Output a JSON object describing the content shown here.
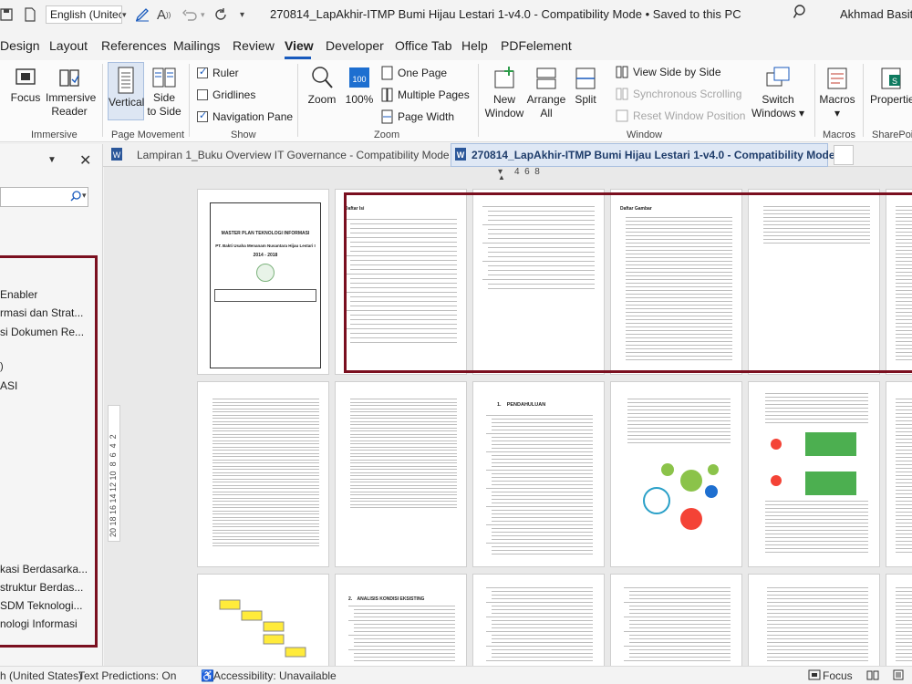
{
  "titlebar": {
    "language": "English (Unitec",
    "title": "270814_LapAkhir-ITMP Bumi Hijau Lestari 1-v4.0  -  Compatibility Mode • Saved to this PC",
    "user": "Akhmad Basith"
  },
  "tabs": [
    "Design",
    "Layout",
    "References",
    "Mailings",
    "Review",
    "View",
    "Developer",
    "Office Tab",
    "Help",
    "PDFelement"
  ],
  "active_tab": "View",
  "ribbon": {
    "immersive": {
      "focus": "Focus",
      "reader_1": "Immersive",
      "reader_2": "Reader",
      "label": "Immersive"
    },
    "page_movement": {
      "vertical": "Vertical",
      "side_1": "Side",
      "side_2": "to Side",
      "label": "Page Movement"
    },
    "show": {
      "ruler": "Ruler",
      "gridlines": "Gridlines",
      "nav_pane": "Navigation Pane",
      "label": "Show"
    },
    "zoom": {
      "zoom": "Zoom",
      "hundred": "100%",
      "one_page": "One Page",
      "multiple_pages": "Multiple Pages",
      "page_width": "Page Width",
      "label": "Zoom"
    },
    "window": {
      "new_1": "New",
      "new_2": "Window",
      "arrange_1": "Arrange",
      "arrange_2": "All",
      "split": "Split",
      "side_by_side": "View Side by Side",
      "sync_scroll": "Synchronous Scrolling",
      "reset_pos": "Reset Window Position",
      "switch_1": "Switch",
      "switch_2": "Windows ▾",
      "label": "Window"
    },
    "macros": {
      "macros": "Macros",
      "label": "Macros"
    },
    "sharepoint": {
      "properties": "Properties",
      "label": "SharePoint"
    }
  },
  "doc_tabs": [
    {
      "label": "Lampiran 1_Buku Overview IT Governance  -  Compatibility Mode"
    },
    {
      "label": "270814_LapAkhir-ITMP Bumi Hijau Lestari 1-v4.0  -  Compatibility Mode"
    }
  ],
  "ruler_numbers": "4  6  8",
  "nav_items": [
    "Enabler",
    "rmasi dan Strat...",
    "si Dokumen Re...",
    "",
    "ASI",
    "kasi Berdasarka...",
    "struktur Berdas...",
    " SDM Teknologi...",
    "nologi Informasi"
  ],
  "vruler_numbers": "20 18 16 14 12 10  8  6  4  2",
  "cover": {
    "title": "MASTER PLAN TEKNOLOGI INFORMASI",
    "company": "PT. Bakti Usaha Menanam Nusantara Hijau Lestari I",
    "years": "2014 - 2018"
  },
  "page_headings": {
    "toc": "Daftar Isi",
    "figures": "Daftar Gambar",
    "intro": "1.    PENDAHULUAN",
    "analysis": "2.    ANALISIS KONDISI EKSISTING"
  },
  "statusbar": {
    "language": "h (United States)",
    "predictions": "Text Predictions: On",
    "accessibility": "Accessibility: Unavailable",
    "focus": "Focus"
  }
}
